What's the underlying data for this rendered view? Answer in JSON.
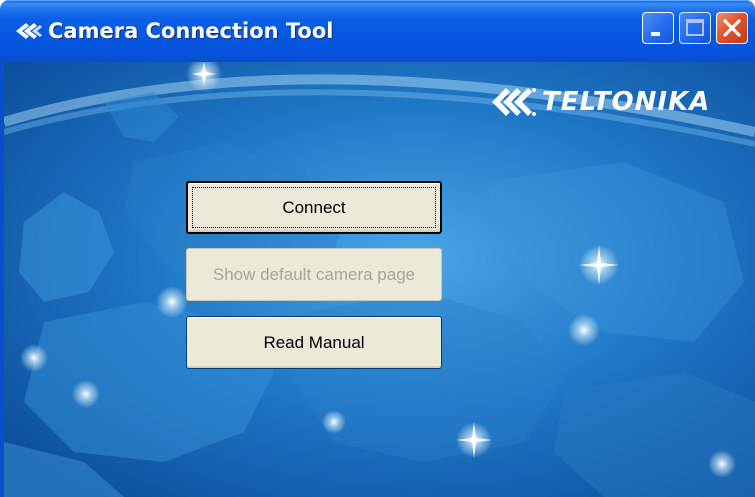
{
  "window": {
    "title": "Camera Connection Tool",
    "controls": {
      "minimize_icon": "minimize-icon",
      "maximize_icon": "maximize-icon",
      "close_icon": "close-icon"
    }
  },
  "brand": {
    "logo_text": "TELTONIKA",
    "logo_icon": "teltonika-logo-icon"
  },
  "buttons": {
    "connect": "Connect",
    "show_default_camera_page": "Show default camera page",
    "read_manual": "Read Manual"
  },
  "colors": {
    "titlebar": "#0a5ce8",
    "background": "#1464b8",
    "button_face": "#ece9d8",
    "close": "#e2532f"
  }
}
